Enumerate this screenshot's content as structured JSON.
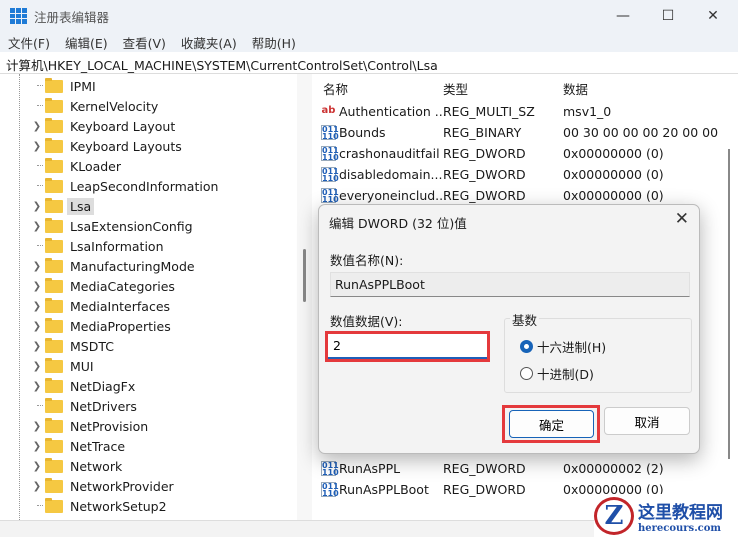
{
  "window": {
    "title": "注册表编辑器",
    "minimize": "—",
    "maximize": "☐",
    "close": "✕"
  },
  "menu": [
    "文件(F)",
    "编辑(E)",
    "查看(V)",
    "收藏夹(A)",
    "帮助(H)"
  ],
  "address": "计算机\\HKEY_LOCAL_MACHINE\\SYSTEM\\CurrentControlSet\\Control\\Lsa",
  "tree": [
    {
      "label": "IPMI",
      "expandable": false
    },
    {
      "label": "KernelVelocity",
      "expandable": false
    },
    {
      "label": "Keyboard Layout",
      "expandable": true
    },
    {
      "label": "Keyboard Layouts",
      "expandable": true
    },
    {
      "label": "KLoader",
      "expandable": false
    },
    {
      "label": "LeapSecondInformation",
      "expandable": false
    },
    {
      "label": "Lsa",
      "expandable": true,
      "selected": true
    },
    {
      "label": "LsaExtensionConfig",
      "expandable": true
    },
    {
      "label": "LsaInformation",
      "expandable": false
    },
    {
      "label": "ManufacturingMode",
      "expandable": true
    },
    {
      "label": "MediaCategories",
      "expandable": true
    },
    {
      "label": "MediaInterfaces",
      "expandable": true
    },
    {
      "label": "MediaProperties",
      "expandable": true
    },
    {
      "label": "MSDTC",
      "expandable": true
    },
    {
      "label": "MUI",
      "expandable": true
    },
    {
      "label": "NetDiagFx",
      "expandable": true
    },
    {
      "label": "NetDrivers",
      "expandable": false
    },
    {
      "label": "NetProvision",
      "expandable": true
    },
    {
      "label": "NetTrace",
      "expandable": true
    },
    {
      "label": "Network",
      "expandable": true
    },
    {
      "label": "NetworkProvider",
      "expandable": true
    },
    {
      "label": "NetworkSetup2",
      "expandable": false
    }
  ],
  "list": {
    "headers": {
      "name": "名称",
      "type": "类型",
      "data": "数据"
    },
    "rows_top": [
      {
        "icon": "ab",
        "name": "Authentication ...",
        "type": "REG_MULTI_SZ",
        "data": "msv1_0"
      },
      {
        "icon": "bin",
        "name": "Bounds",
        "type": "REG_BINARY",
        "data": "00 30 00 00 00 20 00 00"
      },
      {
        "icon": "bin",
        "name": "crashonauditfail",
        "type": "REG_DWORD",
        "data": "0x00000000 (0)"
      },
      {
        "icon": "bin",
        "name": "disabledomain...",
        "type": "REG_DWORD",
        "data": "0x00000000 (0)"
      },
      {
        "icon": "bin",
        "name": "everyoneinclud...",
        "type": "REG_DWORD",
        "data": "0x00000000 (0)"
      }
    ],
    "rows_bottom": [
      {
        "icon": "bin",
        "name": "RunAsPPL",
        "type": "REG_DWORD",
        "data": "0x00000002 (2)"
      },
      {
        "icon": "bin",
        "name": "RunAsPPLBoot",
        "type": "REG_DWORD",
        "data": "0x00000000 (0)"
      }
    ]
  },
  "dialog": {
    "title": "编辑 DWORD (32 位)值",
    "close": "✕",
    "name_label": "数值名称(N):",
    "name_value": "RunAsPPLBoot",
    "data_label": "数值数据(V):",
    "data_value": "2",
    "base_label": "基数",
    "hex_label": "十六进制(H)",
    "dec_label": "十进制(D)",
    "base_selected": "hex",
    "ok": "确定",
    "cancel": "取消"
  },
  "watermark": {
    "logo": "Z",
    "title": "这里教程网",
    "url": "herecours.com"
  }
}
